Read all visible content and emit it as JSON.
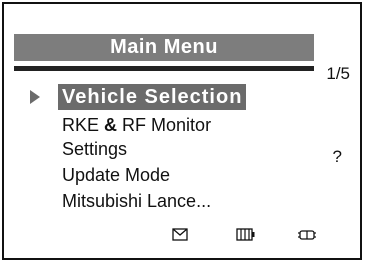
{
  "header": {
    "title": "Main Menu",
    "page_indicator": "1/5"
  },
  "menu": {
    "items": [
      {
        "label": "Vehicle Selection",
        "selected": true
      },
      {
        "label_part1": "RKE",
        "label_amp": "&",
        "label_part2": "RF Monitor",
        "selected": false
      },
      {
        "label": "Settings",
        "selected": false
      },
      {
        "label": "Update Mode",
        "selected": false
      },
      {
        "label": "Mitsubishi Lance...",
        "selected": false
      }
    ],
    "help_mark": "?"
  },
  "status_bar": {
    "icons": [
      "envelope-icon",
      "battery-icon",
      "vehicle-icon"
    ]
  },
  "colors": {
    "title_bg": "#7d7d7d",
    "selection_bg": "#6b6b6b",
    "text": "#111111"
  }
}
